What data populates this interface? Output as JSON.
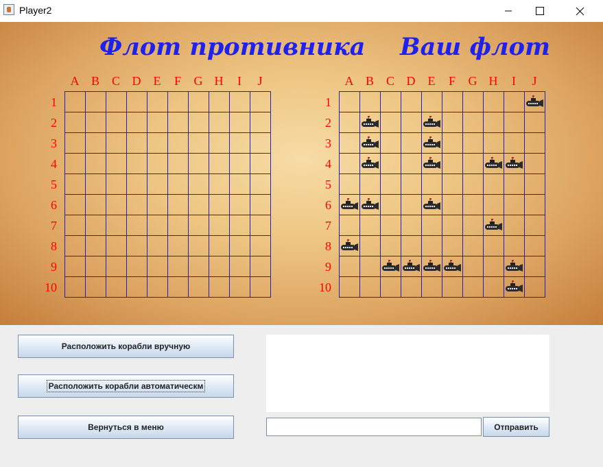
{
  "window": {
    "title": "Player2",
    "minimize_icon": "minimize-icon",
    "maximize_icon": "maximize-icon",
    "close_icon": "close-icon"
  },
  "boards": {
    "enemy_title": "Флот противника",
    "own_title": "Ваш флот",
    "columns": [
      "A",
      "B",
      "C",
      "D",
      "E",
      "F",
      "G",
      "H",
      "I",
      "J"
    ],
    "rows": [
      "1",
      "2",
      "3",
      "4",
      "5",
      "6",
      "7",
      "8",
      "9",
      "10"
    ],
    "enemy_marks": [],
    "own_ships": [
      "J1",
      "B2",
      "E2",
      "B3",
      "E3",
      "B4",
      "E4",
      "H4",
      "I4",
      "A6",
      "B6",
      "E6",
      "H7",
      "A8",
      "C9",
      "D9",
      "E9",
      "F9",
      "I9",
      "I10"
    ]
  },
  "controls": {
    "place_manual": "Расположить корабли вручную",
    "place_auto": "Расположить корабли автоматическм",
    "back_menu": "Вернуться в меню",
    "send": "Отправить",
    "chat_text": "",
    "message_value": ""
  },
  "colors": {
    "heading": "#1d22ee",
    "labels": "#ff0000",
    "grid_lines": "#2020c8"
  }
}
